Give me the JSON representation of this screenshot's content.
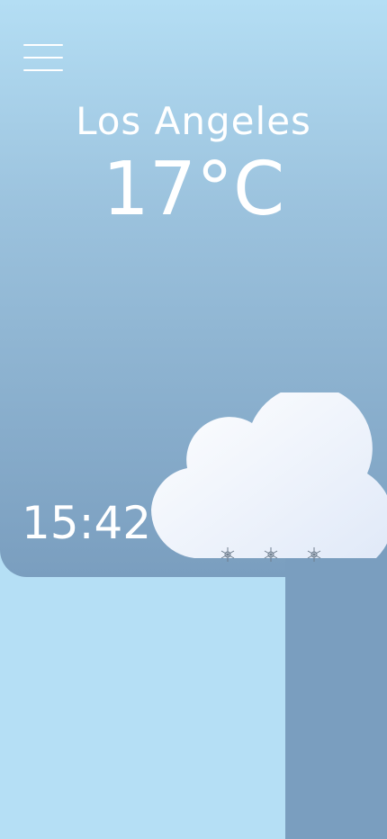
{
  "menu": {
    "icon": "hamburger-menu-icon"
  },
  "weather": {
    "city": "Los Angeles",
    "temperature": "17°C",
    "time": "15:42",
    "condition_icon": "cloud-snow-icon"
  },
  "colors": {
    "sky_top": "#b4def4",
    "sky_bottom": "#7a9ebf",
    "background": "#b5dff5",
    "text": "#ffffff",
    "snowflake": "#6e7d8d"
  }
}
